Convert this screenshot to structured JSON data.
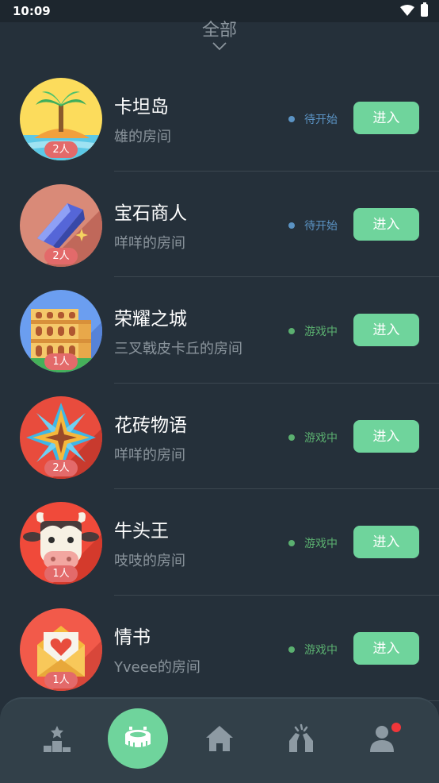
{
  "status_bar": {
    "time": "10:09"
  },
  "filter": {
    "label": "全部"
  },
  "rooms": [
    {
      "name": "卡坦岛",
      "owner": "雄的房间",
      "players": "2人",
      "status": "待开始",
      "status_color": "#5b93c4",
      "button": "进入"
    },
    {
      "name": "宝石商人",
      "owner": "咩咩的房间",
      "players": "2人",
      "status": "待开始",
      "status_color": "#5b93c4",
      "button": "进入"
    },
    {
      "name": "荣耀之城",
      "owner": "三叉戟皮卡丘的房间",
      "players": "1人",
      "status": "游戏中",
      "status_color": "#5bb070",
      "button": "进入"
    },
    {
      "name": "花砖物语",
      "owner": "咩咩的房间",
      "players": "2人",
      "status": "游戏中",
      "status_color": "#5bb070",
      "button": "进入"
    },
    {
      "name": "牛头王",
      "owner": "吱吱的房间",
      "players": "1人",
      "status": "游戏中",
      "status_color": "#5bb070",
      "button": "进入"
    },
    {
      "name": "情书",
      "owner": "Yveee的房间",
      "players": "1人",
      "status": "游戏中",
      "status_color": "#5bb070",
      "button": "进入"
    }
  ],
  "tab_bar": {
    "tabs": [
      {
        "icon": "podium-icon",
        "active": false
      },
      {
        "icon": "stadium-icon",
        "active": true
      },
      {
        "icon": "home-icon",
        "active": false
      },
      {
        "icon": "high-five-icon",
        "active": false
      },
      {
        "icon": "profile-icon",
        "active": false,
        "notification": true
      }
    ],
    "accent": "#6fd49c",
    "notification_color": "#f0363a"
  }
}
